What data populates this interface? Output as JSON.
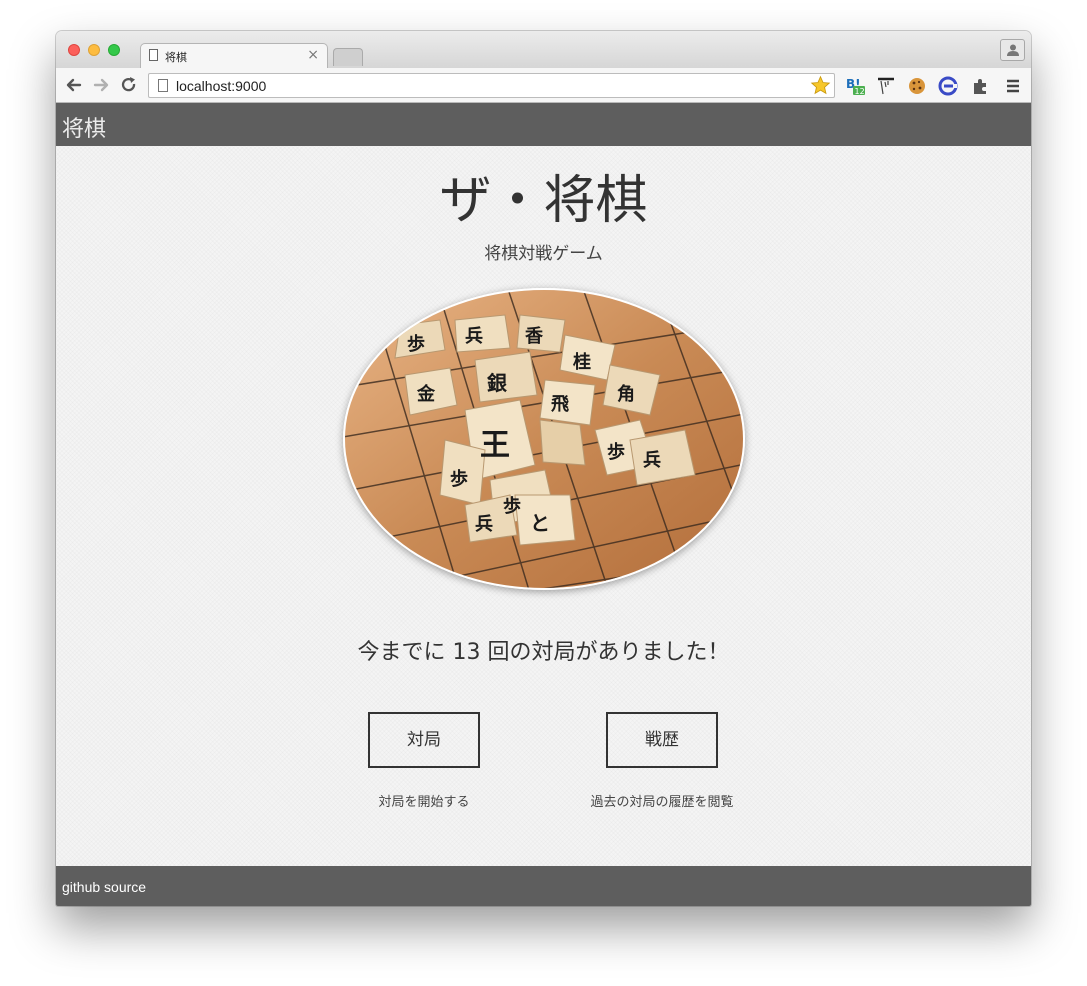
{
  "browser": {
    "tab_title": "将棋",
    "tab_close": "×",
    "url": "localhost:9000",
    "extensions": [
      "bookmark-icon",
      "hatena-icon",
      "ruler-icon",
      "cookie-icon",
      "c-icon",
      "puzzle-icon"
    ],
    "extension_badge": "12"
  },
  "header": {
    "brand": "将棋"
  },
  "main": {
    "title": "ザ・将棋",
    "subtitle": "将棋対戦ゲーム",
    "hero_image": "shogi-pieces-on-board",
    "game_count_text": "今までに 13 回の対局がありました！",
    "game_count": 13,
    "play_button": "対局",
    "play_caption": "対局を開始する",
    "history_button": "戦歴",
    "history_caption": "過去の対局の履歴を閲覧"
  },
  "footer": {
    "link": "github source"
  },
  "colors": {
    "header_bg": "#5e5e5e",
    "page_bg": "#f4f4f4",
    "text": "#333333",
    "board_wood": "#c98a55"
  }
}
